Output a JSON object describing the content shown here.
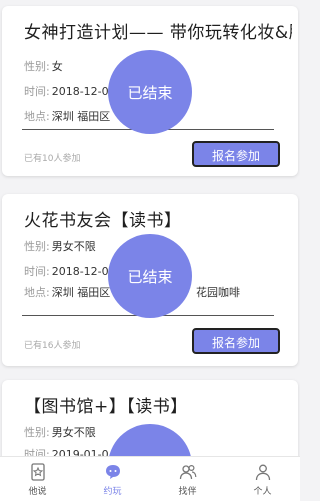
{
  "events": [
    {
      "title": "女神打造计划—— 带你玩转化妆&服",
      "gender_label": "性别:",
      "gender": "女",
      "time_label": "时间:",
      "time": "2018-12-0",
      "place_label": "地点:",
      "place": "深圳 福田区",
      "joined": "已有10人参加",
      "status": "已结束",
      "join_button": "报名参加"
    },
    {
      "title": "火花书友会【读书】",
      "gender_label": "性别:",
      "gender": "男女不限",
      "time_label": "时间:",
      "time": "2018-12-0",
      "place_label": "地点:",
      "place": "深圳 福田区",
      "place_extra": "花园咖啡",
      "joined": "已有16人参加",
      "status": "已结束",
      "join_button": "报名参加"
    },
    {
      "title": "【图书馆+】【读书】",
      "gender_label": "性别:",
      "gender": "男女不限",
      "time_label": "时间:",
      "time": "2019-01-0"
    }
  ],
  "tabbar": {
    "items": [
      {
        "label": "他说",
        "icon": "star-page-icon"
      },
      {
        "label": "约玩",
        "icon": "chat-bubble-icon",
        "active": true
      },
      {
        "label": "找伴",
        "icon": "people-icon"
      },
      {
        "label": "个人",
        "icon": "person-icon"
      }
    ],
    "accent": "#7b84e8"
  }
}
